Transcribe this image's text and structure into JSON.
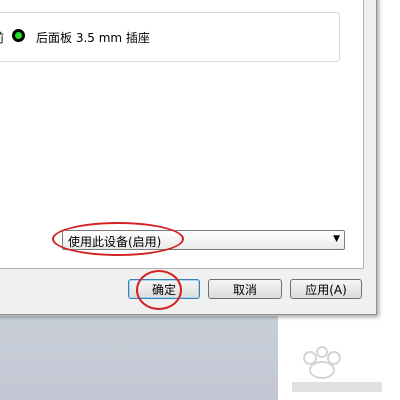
{
  "endpoints": {
    "front_label_partial": "前",
    "rear_label": "后面板 3.5 mm 插座",
    "jack_color": "#22e12a"
  },
  "device_usage": {
    "selected_value": "使用此设备(启用)"
  },
  "buttons": {
    "ok_label": "确定",
    "cancel_label": "取消",
    "apply_label": "应用(A)"
  },
  "colors": {
    "annotation": "#d42020",
    "dialog_bg": "#f0f0f0",
    "desktop_bg": "#c6cbd6"
  }
}
